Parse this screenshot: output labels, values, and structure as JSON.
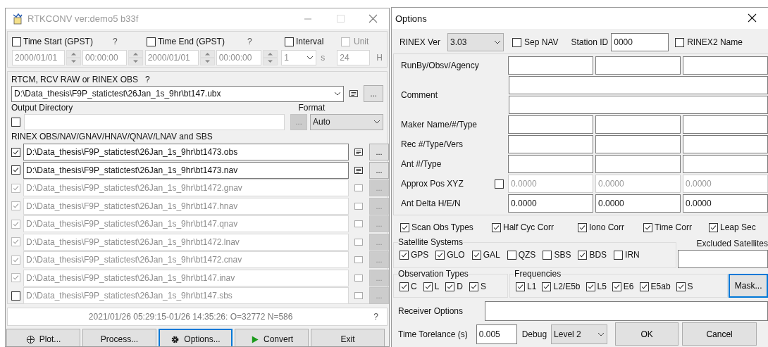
{
  "rtkconv": {
    "title": "RTKCONV ver:demo5 b33f",
    "time_start": {
      "label": "Time Start (GPST)",
      "checked": false,
      "help": "?",
      "date": "2000/01/01",
      "time": "00:00:00"
    },
    "time_end": {
      "label": "Time End (GPST)",
      "checked": false,
      "help": "?",
      "date": "2000/01/01",
      "time": "00:00:00"
    },
    "interval": {
      "label": "Interval",
      "checked": false,
      "value": "1",
      "unit": "s"
    },
    "unit": {
      "label": "Unit",
      "checked": false,
      "disabled": true,
      "value": "24",
      "unit": "H"
    },
    "input": {
      "label": "RTCM, RCV RAW or RINEX OBS",
      "help": "?",
      "path": "D:\\Data_thesis\\F9P_statictest\\26Jan_1s_9hr\\bt147.ubx",
      "browse": "..."
    },
    "output_directory": {
      "label": "Output Directory",
      "checked": false,
      "browse": "..."
    },
    "format": {
      "label": "Format",
      "value": "Auto"
    },
    "outputs_label": "RINEX OBS/NAV/GNAV/HNAV/QNAV/LNAV and SBS",
    "output_files": [
      {
        "checked": true,
        "checkbox_disabled": false,
        "disabled": false,
        "path": "D:\\Data_thesis\\F9P_statictest\\26Jan_1s_9hr\\bt1473.obs",
        "browse": "..."
      },
      {
        "checked": true,
        "checkbox_disabled": false,
        "disabled": false,
        "path": "D:\\Data_thesis\\F9P_statictest\\26Jan_1s_9hr\\bt1473.nav",
        "browse": "..."
      },
      {
        "checked": true,
        "checkbox_disabled": true,
        "disabled": true,
        "path": "D:\\Data_thesis\\F9P_statictest\\26Jan_1s_9hr\\bt1472.gnav",
        "browse": "..."
      },
      {
        "checked": true,
        "checkbox_disabled": true,
        "disabled": true,
        "path": "D:\\Data_thesis\\F9P_statictest\\26Jan_1s_9hr\\bt147.hnav",
        "browse": "..."
      },
      {
        "checked": true,
        "checkbox_disabled": true,
        "disabled": true,
        "path": "D:\\Data_thesis\\F9P_statictest\\26Jan_1s_9hr\\bt147.qnav",
        "browse": "..."
      },
      {
        "checked": true,
        "checkbox_disabled": true,
        "disabled": true,
        "path": "D:\\Data_thesis\\F9P_statictest\\26Jan_1s_9hr\\bt1472.lnav",
        "browse": "..."
      },
      {
        "checked": true,
        "checkbox_disabled": true,
        "disabled": true,
        "path": "D:\\Data_thesis\\F9P_statictest\\26Jan_1s_9hr\\bt1472.cnav",
        "browse": "..."
      },
      {
        "checked": true,
        "checkbox_disabled": true,
        "disabled": true,
        "path": "D:\\Data_thesis\\F9P_statictest\\26Jan_1s_9hr\\bt147.inav",
        "browse": "..."
      },
      {
        "checked": false,
        "checkbox_disabled": false,
        "disabled": true,
        "path": "D:\\Data_thesis\\F9P_statictest\\26Jan_1s_9hr\\bt147.sbs",
        "browse": "..."
      }
    ],
    "status": {
      "text": "2021/01/26 05:29:15-01/26 14:35:26: O=32772 N=586",
      "help": "?"
    },
    "buttons": [
      {
        "label": "Plot...",
        "focused": false
      },
      {
        "label": "Process...",
        "focused": false
      },
      {
        "label": "Options...",
        "focused": true
      },
      {
        "label": "Convert",
        "focused": false
      },
      {
        "label": "Exit",
        "focused": false
      }
    ]
  },
  "options": {
    "title": "Options",
    "rinex_ver": {
      "label": "RINEX Ver",
      "value": "3.03"
    },
    "sep_nav": {
      "label": "Sep NAV",
      "checked": false
    },
    "station_id": {
      "label": "Station ID",
      "value": "0000"
    },
    "rinex2_name": {
      "label": "RINEX2 Name",
      "checked": false
    },
    "header_rows": [
      {
        "kind": "triple",
        "label": "RunBy/Obsv/Agency"
      },
      {
        "kind": "double",
        "label": "Comment"
      },
      {
        "kind": "triple",
        "label": "Maker Name/#/Type"
      },
      {
        "kind": "triple",
        "label": "Rec #/Type/Vers"
      },
      {
        "kind": "triple",
        "label": "Ant #/Type"
      },
      {
        "kind": "values",
        "label": "Approx Pos XYZ",
        "checked": false,
        "values": [
          "0.0000",
          "0.0000",
          "0.0000"
        ]
      },
      {
        "kind": "values",
        "label": "Ant Delta H/E/N",
        "values": [
          "0.0000",
          "0.0000",
          "0.0000"
        ]
      }
    ],
    "flags": [
      {
        "label": "Scan Obs Types",
        "checked": true
      },
      {
        "label": "Half Cyc Corr",
        "checked": true
      },
      {
        "label": "Iono Corr",
        "checked": true
      },
      {
        "label": "Time Corr",
        "checked": true
      },
      {
        "label": "Leap Sec",
        "checked": true
      }
    ],
    "satellite_systems": {
      "label": "Satellite Systems",
      "items": [
        {
          "label": "GPS",
          "checked": true
        },
        {
          "label": "GLO",
          "checked": true
        },
        {
          "label": "GAL",
          "checked": true
        },
        {
          "label": "QZS",
          "checked": false
        },
        {
          "label": "SBS",
          "checked": false
        },
        {
          "label": "BDS",
          "checked": true
        },
        {
          "label": "IRN",
          "checked": false
        }
      ]
    },
    "excluded_satellites": {
      "label": "Excluded Satellites"
    },
    "observation_types": {
      "label": "Observation Types",
      "items": [
        {
          "label": "C",
          "checked": true
        },
        {
          "label": "L",
          "checked": true
        },
        {
          "label": "D",
          "checked": true
        },
        {
          "label": "S",
          "checked": true
        }
      ]
    },
    "frequencies": {
      "label": "Frequencies",
      "items": [
        {
          "label": "L1",
          "checked": true
        },
        {
          "label": "L2/E5b",
          "checked": true
        },
        {
          "label": "L5",
          "checked": true
        },
        {
          "label": "E6",
          "checked": true
        },
        {
          "label": "E5ab",
          "checked": true
        },
        {
          "label": "S",
          "checked": true
        }
      ]
    },
    "mask_button": {
      "label": "Mask...",
      "focused": true
    },
    "receiver_options": {
      "label": "Receiver Options"
    },
    "time_tolerance": {
      "label": "Time Torelance (s)",
      "value": "0.005"
    },
    "debug": {
      "label": "Debug",
      "value": "Level 2"
    },
    "buttons": [
      "OK",
      "Cancel"
    ]
  }
}
